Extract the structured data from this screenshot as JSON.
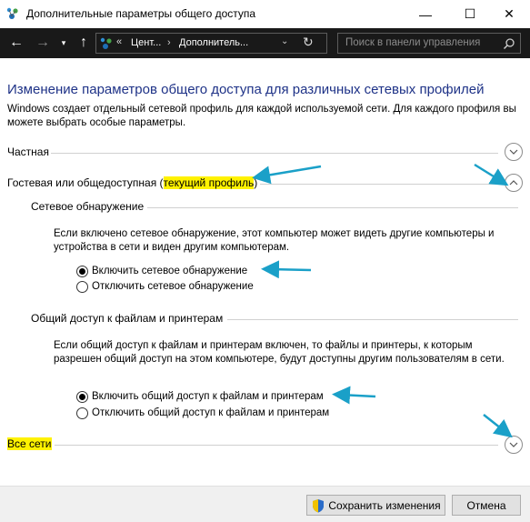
{
  "window": {
    "title": "Дополнительные параметры общего доступа",
    "minimize_glyph": "—",
    "maximize_glyph": "☐",
    "close_glyph": "✕",
    "app_icon": "network-sharing-icon"
  },
  "nav": {
    "back_glyph": "←",
    "forward_glyph": "→",
    "recent_glyph": "▾",
    "up_glyph": "↑",
    "address": {
      "overflow": "«",
      "crumbs": [
        "Цент...",
        "Дополнитель..."
      ],
      "separator": "›",
      "dropdown_glyph": "⌄",
      "refresh_glyph": "↻"
    },
    "search": {
      "placeholder": "Поиск в панели управления",
      "icon": "search-icon"
    }
  },
  "content": {
    "heading": "Изменение параметров общего доступа для различных сетевых профилей",
    "intro": "Windows создает отдельный сетевой профиль для каждой используемой сети. Для каждого профиля вы можете выбрать особые параметры.",
    "sections": {
      "private": {
        "label": "Частная",
        "expanded": false
      },
      "guest": {
        "label_prefix": "Гостевая или общедоступная (",
        "label_highlight": "текущий профиль",
        "label_suffix": ")",
        "expanded": true,
        "discovery": {
          "title": "Сетевое обнаружение",
          "description": "Если включено сетевое обнаружение, этот компьютер может видеть другие компьютеры и устройства в сети и виден другим компьютерам.",
          "options": [
            {
              "label": "Включить сетевое обнаружение",
              "checked": true
            },
            {
              "label": "Отключить сетевое обнаружение",
              "checked": false
            }
          ]
        },
        "file_sharing": {
          "title": "Общий доступ к файлам и принтерам",
          "description": "Если общий доступ к файлам и принтерам включен, то файлы и принтеры, к которым разрешен общий доступ на этом компьютере, будут доступны другим пользователям в сети.",
          "options": [
            {
              "label": "Включить общий доступ к файлам и принтерам",
              "checked": true
            },
            {
              "label": "Отключить общий доступ к файлам и принтерам",
              "checked": false
            }
          ]
        }
      },
      "all_networks": {
        "label": "Все сети",
        "expanded": false
      }
    }
  },
  "footer": {
    "save_label": "Сохранить изменения",
    "cancel_label": "Отмена"
  },
  "colors": {
    "heading": "#1e3287",
    "highlight": "#fff200",
    "annotation_arrow": "#1aa0c8",
    "navbar_bg": "#191919"
  }
}
